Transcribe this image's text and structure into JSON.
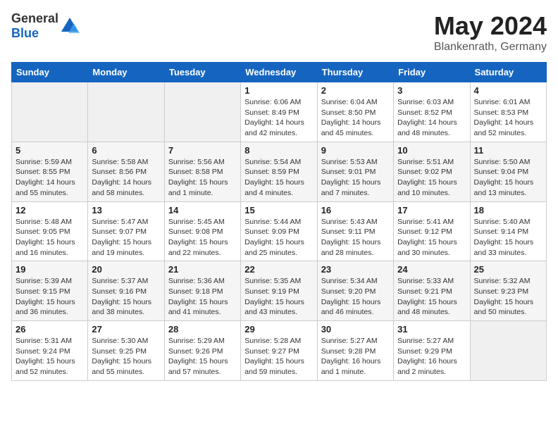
{
  "header": {
    "logo_general": "General",
    "logo_blue": "Blue",
    "title": "May 2024",
    "subtitle": "Blankenrath, Germany"
  },
  "weekdays": [
    "Sunday",
    "Monday",
    "Tuesday",
    "Wednesday",
    "Thursday",
    "Friday",
    "Saturday"
  ],
  "weeks": [
    [
      {
        "day": "",
        "info": ""
      },
      {
        "day": "",
        "info": ""
      },
      {
        "day": "",
        "info": ""
      },
      {
        "day": "1",
        "info": "Sunrise: 6:06 AM\nSunset: 8:49 PM\nDaylight: 14 hours\nand 42 minutes."
      },
      {
        "day": "2",
        "info": "Sunrise: 6:04 AM\nSunset: 8:50 PM\nDaylight: 14 hours\nand 45 minutes."
      },
      {
        "day": "3",
        "info": "Sunrise: 6:03 AM\nSunset: 8:52 PM\nDaylight: 14 hours\nand 48 minutes."
      },
      {
        "day": "4",
        "info": "Sunrise: 6:01 AM\nSunset: 8:53 PM\nDaylight: 14 hours\nand 52 minutes."
      }
    ],
    [
      {
        "day": "5",
        "info": "Sunrise: 5:59 AM\nSunset: 8:55 PM\nDaylight: 14 hours\nand 55 minutes."
      },
      {
        "day": "6",
        "info": "Sunrise: 5:58 AM\nSunset: 8:56 PM\nDaylight: 14 hours\nand 58 minutes."
      },
      {
        "day": "7",
        "info": "Sunrise: 5:56 AM\nSunset: 8:58 PM\nDaylight: 15 hours\nand 1 minute."
      },
      {
        "day": "8",
        "info": "Sunrise: 5:54 AM\nSunset: 8:59 PM\nDaylight: 15 hours\nand 4 minutes."
      },
      {
        "day": "9",
        "info": "Sunrise: 5:53 AM\nSunset: 9:01 PM\nDaylight: 15 hours\nand 7 minutes."
      },
      {
        "day": "10",
        "info": "Sunrise: 5:51 AM\nSunset: 9:02 PM\nDaylight: 15 hours\nand 10 minutes."
      },
      {
        "day": "11",
        "info": "Sunrise: 5:50 AM\nSunset: 9:04 PM\nDaylight: 15 hours\nand 13 minutes."
      }
    ],
    [
      {
        "day": "12",
        "info": "Sunrise: 5:48 AM\nSunset: 9:05 PM\nDaylight: 15 hours\nand 16 minutes."
      },
      {
        "day": "13",
        "info": "Sunrise: 5:47 AM\nSunset: 9:07 PM\nDaylight: 15 hours\nand 19 minutes."
      },
      {
        "day": "14",
        "info": "Sunrise: 5:45 AM\nSunset: 9:08 PM\nDaylight: 15 hours\nand 22 minutes."
      },
      {
        "day": "15",
        "info": "Sunrise: 5:44 AM\nSunset: 9:09 PM\nDaylight: 15 hours\nand 25 minutes."
      },
      {
        "day": "16",
        "info": "Sunrise: 5:43 AM\nSunset: 9:11 PM\nDaylight: 15 hours\nand 28 minutes."
      },
      {
        "day": "17",
        "info": "Sunrise: 5:41 AM\nSunset: 9:12 PM\nDaylight: 15 hours\nand 30 minutes."
      },
      {
        "day": "18",
        "info": "Sunrise: 5:40 AM\nSunset: 9:14 PM\nDaylight: 15 hours\nand 33 minutes."
      }
    ],
    [
      {
        "day": "19",
        "info": "Sunrise: 5:39 AM\nSunset: 9:15 PM\nDaylight: 15 hours\nand 36 minutes."
      },
      {
        "day": "20",
        "info": "Sunrise: 5:37 AM\nSunset: 9:16 PM\nDaylight: 15 hours\nand 38 minutes."
      },
      {
        "day": "21",
        "info": "Sunrise: 5:36 AM\nSunset: 9:18 PM\nDaylight: 15 hours\nand 41 minutes."
      },
      {
        "day": "22",
        "info": "Sunrise: 5:35 AM\nSunset: 9:19 PM\nDaylight: 15 hours\nand 43 minutes."
      },
      {
        "day": "23",
        "info": "Sunrise: 5:34 AM\nSunset: 9:20 PM\nDaylight: 15 hours\nand 46 minutes."
      },
      {
        "day": "24",
        "info": "Sunrise: 5:33 AM\nSunset: 9:21 PM\nDaylight: 15 hours\nand 48 minutes."
      },
      {
        "day": "25",
        "info": "Sunrise: 5:32 AM\nSunset: 9:23 PM\nDaylight: 15 hours\nand 50 minutes."
      }
    ],
    [
      {
        "day": "26",
        "info": "Sunrise: 5:31 AM\nSunset: 9:24 PM\nDaylight: 15 hours\nand 52 minutes."
      },
      {
        "day": "27",
        "info": "Sunrise: 5:30 AM\nSunset: 9:25 PM\nDaylight: 15 hours\nand 55 minutes."
      },
      {
        "day": "28",
        "info": "Sunrise: 5:29 AM\nSunset: 9:26 PM\nDaylight: 15 hours\nand 57 minutes."
      },
      {
        "day": "29",
        "info": "Sunrise: 5:28 AM\nSunset: 9:27 PM\nDaylight: 15 hours\nand 59 minutes."
      },
      {
        "day": "30",
        "info": "Sunrise: 5:27 AM\nSunset: 9:28 PM\nDaylight: 16 hours\nand 1 minute."
      },
      {
        "day": "31",
        "info": "Sunrise: 5:27 AM\nSunset: 9:29 PM\nDaylight: 16 hours\nand 2 minutes."
      },
      {
        "day": "",
        "info": ""
      }
    ]
  ]
}
